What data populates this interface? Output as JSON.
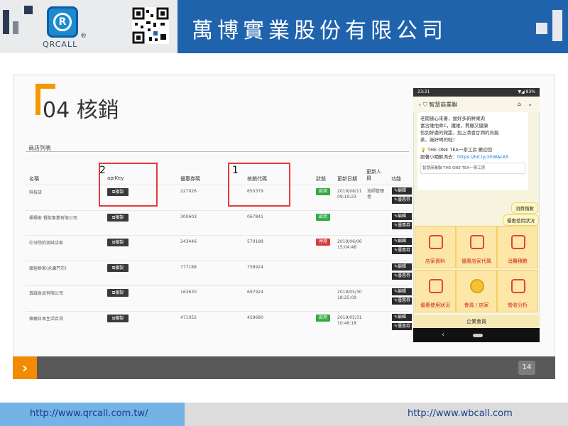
{
  "header": {
    "company": "萬博實業股份有限公司",
    "logo_text": "QRCALL",
    "logo_letter": "R",
    "reg_mark": "®"
  },
  "slide": {
    "section_title": "04 核銷",
    "page_number": "14",
    "arrow": "›"
  },
  "table": {
    "caption": "商店列表",
    "columns": [
      "名稱",
      "apiKey",
      "優惠券碼",
      "核銷代碼",
      "狀態",
      "更新日期",
      "更新人員",
      "功能"
    ],
    "copy_label": "複製",
    "edit_label": "編輯",
    "coupon_label": "優惠券",
    "rows": [
      {
        "name": "科技店",
        "code": "227026",
        "verify": "650379",
        "status": "啟用",
        "status_type": "ok",
        "date": "2019/08/11",
        "time": "09:19:23",
        "updater": "池師管理者"
      },
      {
        "name": "揮揮家 餐飲事業有限公司",
        "code": "300603",
        "verify": "067841",
        "status": "啟用",
        "status_type": "ok",
        "date": "",
        "time": "",
        "updater": ""
      },
      {
        "name": "中分院的測試店家",
        "code": "243446",
        "verify": "570189",
        "status": "停用",
        "status_type": "stop",
        "date": "2019/06/06",
        "time": "15:04:48",
        "updater": ""
      },
      {
        "name": "鎮裕鮮家(永康門市)",
        "code": "777188",
        "verify": "758924",
        "status": "",
        "status_type": "",
        "date": "",
        "time": "",
        "updater": ""
      },
      {
        "name": "真誠食品有限公司",
        "code": "163630",
        "verify": "697924",
        "status": "",
        "status_type": "",
        "date": "2019/05/30",
        "time": "18:25:09",
        "updater": ""
      },
      {
        "name": "格爾日本生活百貨",
        "code": "471052",
        "verify": "459680",
        "status": "啟用",
        "status_type": "ok",
        "date": "2019/05/31",
        "time": "10:46:18",
        "updater": ""
      }
    ],
    "marker_1": "1",
    "marker_2": "2"
  },
  "phone": {
    "status_time": "23:21",
    "status_right": "▼◢ 83%",
    "chat_name": "智慧商業聯",
    "chat_lines": [
      "老闆佛心來著，拔好多新鮮果肉",
      "富含維他命C，纖維，費願又健康",
      "恰到好處的微甜，加上清香甘潤的烏龍",
      "茶，敲好喝的啦！"
    ],
    "promo": "💡 THE ONE TEA一茶工房 歡迎您",
    "link_prefix": "跟著小關解渴去：",
    "link": "https://bit.ly/2EWAcA5",
    "card_title": "智慧商業聯 THE ONE TEA一茶工房",
    "bubble1": "消費積數",
    "bubble2": "優惠使用狀況",
    "tiles": [
      "店家資料",
      "優惠店家代碼",
      "消費積數",
      "優惠使用狀況",
      "會員 / 店家",
      "營收分析"
    ],
    "bottom": "企業會員",
    "nav_back": "‹"
  },
  "footer": {
    "url_left": "http://www.qrcall.com.tw/",
    "url_right": "http://www.wbcall.com"
  },
  "colors": {
    "header_blue": "#1f63ad",
    "accent_orange": "#f39800",
    "ok_green": "#33aa44",
    "stop_red": "#d63b3b",
    "highlight_red": "#e33b3b"
  }
}
